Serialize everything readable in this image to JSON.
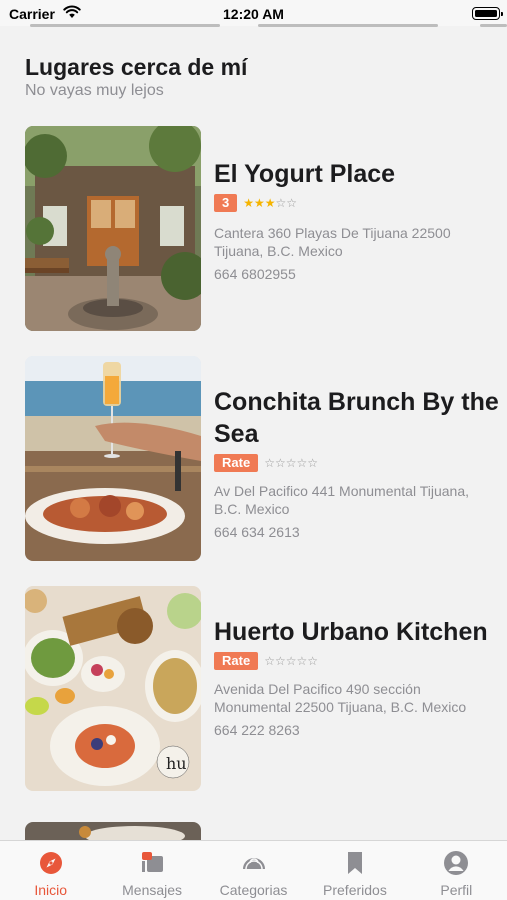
{
  "status_bar": {
    "carrier": "Carrier",
    "time": "12:20 AM"
  },
  "section": {
    "title": "Lugares cerca de mí",
    "subtitle": "No vayas muy lejos"
  },
  "places": [
    {
      "name": "El Yogurt Place",
      "badge": "3",
      "rating": 3,
      "address": "Cantera 360 Playas De Tijuana 22500 Tijuana, B.C. Mexico",
      "phone": "664 6802955"
    },
    {
      "name": "Conchita Brunch By the Sea",
      "badge": "Rate",
      "rating": 0,
      "address": "Av Del Pacifico 441 Monumental Tijuana, B.C. Mexico",
      "phone": "664 634 2613"
    },
    {
      "name": "Huerto Urbano Kitchen",
      "badge": "Rate",
      "rating": 0,
      "address": "Avenida Del Pacifico 490 sección Monumental 22500 Tijuana, B.C. Mexico",
      "phone": "664 222 8263"
    }
  ],
  "tab_bar": {
    "tabs": [
      {
        "label": "Inicio",
        "icon": "compass-icon",
        "active": true
      },
      {
        "label": "Mensajes",
        "icon": "messages-icon",
        "active": false
      },
      {
        "label": "Categorias",
        "icon": "tacos-icon",
        "active": false
      },
      {
        "label": "Preferidos",
        "icon": "bookmark-icon",
        "active": false
      },
      {
        "label": "Perfil",
        "icon": "profile-icon",
        "active": false
      }
    ]
  },
  "colors": {
    "accent": "#f07a54",
    "active_tab": "#e8573a",
    "star": "#f5b400"
  }
}
